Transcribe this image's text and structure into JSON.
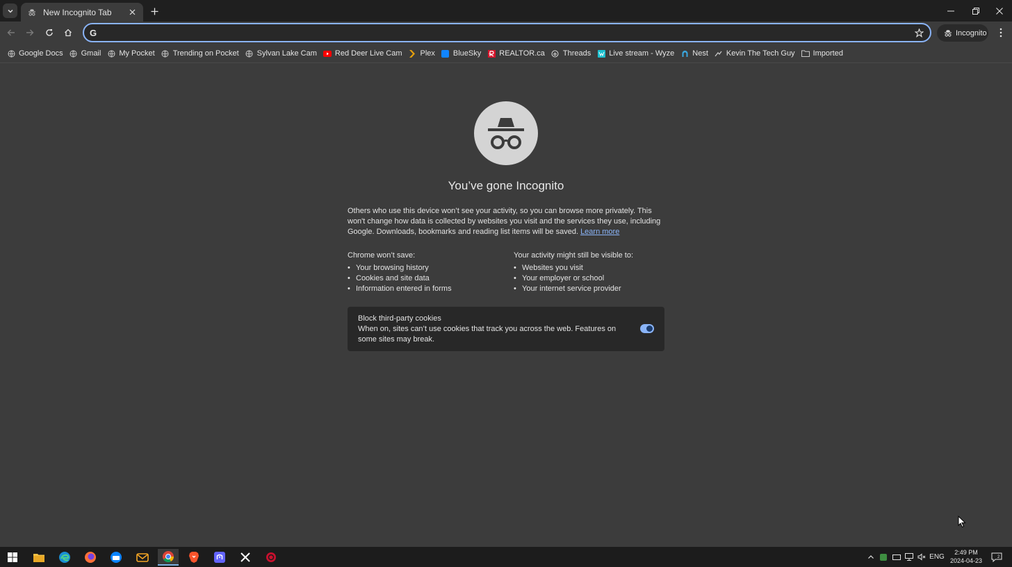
{
  "tab": {
    "title": "New Incognito Tab"
  },
  "toolbar": {
    "omnibox_value": "",
    "omnibox_prefix": "G",
    "incognito_label": "Incognito"
  },
  "bookmarks": [
    {
      "label": "Google Docs",
      "icon": "globe-icon",
      "color": "#c8c8c8"
    },
    {
      "label": "Gmail",
      "icon": "globe-icon",
      "color": "#c8c8c8"
    },
    {
      "label": "My Pocket",
      "icon": "globe-icon",
      "color": "#c8c8c8"
    },
    {
      "label": "Trending on Pocket",
      "icon": "globe-icon",
      "color": "#c8c8c8"
    },
    {
      "label": "Sylvan Lake Cam",
      "icon": "globe-icon",
      "color": "#c8c8c8"
    },
    {
      "label": "Red Deer Live Cam",
      "icon": "youtube-icon",
      "color": "#ff0000"
    },
    {
      "label": "Plex",
      "icon": "plex-icon",
      "color": "#e5a00d"
    },
    {
      "label": "BlueSky",
      "icon": "bluesky-icon",
      "color": "#1185fe"
    },
    {
      "label": "REALTOR.ca",
      "icon": "realtor-icon",
      "color": "#d6132a"
    },
    {
      "label": "Threads",
      "icon": "threads-icon",
      "color": "#e3e3e3"
    },
    {
      "label": "Live stream - Wyze",
      "icon": "wyze-icon",
      "color": "#1dc0cf"
    },
    {
      "label": "Nest",
      "icon": "nest-icon",
      "color": "#3aa8e0"
    },
    {
      "label": "Kevin The Tech Guy",
      "icon": "site-icon",
      "color": "#c8c8c8"
    },
    {
      "label": "Imported",
      "icon": "folder-icon",
      "color": "#c8c8c8"
    }
  ],
  "page": {
    "headline": "You’ve gone Incognito",
    "intro": "Others who use this device won’t see your activity, so you can browse more privately. This won't change how data is collected by websites you visit and the services they use, including Google. Downloads, bookmarks and reading list items will be saved.",
    "learn_more": "Learn more",
    "wont_save_title": "Chrome won’t save:",
    "wont_save": [
      "Your browsing history",
      "Cookies and site data",
      "Information entered in forms"
    ],
    "visible_title": "Your activity might still be visible to:",
    "visible": [
      "Websites you visit",
      "Your employer or school",
      "Your internet service provider"
    ],
    "cookies_title": "Block third-party cookies",
    "cookies_desc": "When on, sites can’t use cookies that track you across the web. Features on some sites may break.",
    "cookies_toggle_on": true
  },
  "taskbar": {
    "apps": [
      "windows-start-icon",
      "file-explorer-icon",
      "edge-icon",
      "firefox-icon",
      "thunderbird-icon",
      "mail-icon",
      "chrome-icon",
      "brave-icon",
      "mastodon-icon",
      "x-icon",
      "app-icon"
    ],
    "language": "ENG",
    "time": "2:49 PM",
    "date": "2024-04-23",
    "notification_count": "2"
  },
  "colors": {
    "accent": "#8ab4f8",
    "background": "#3c3c3c",
    "tab_strip": "#1f1f1f"
  }
}
